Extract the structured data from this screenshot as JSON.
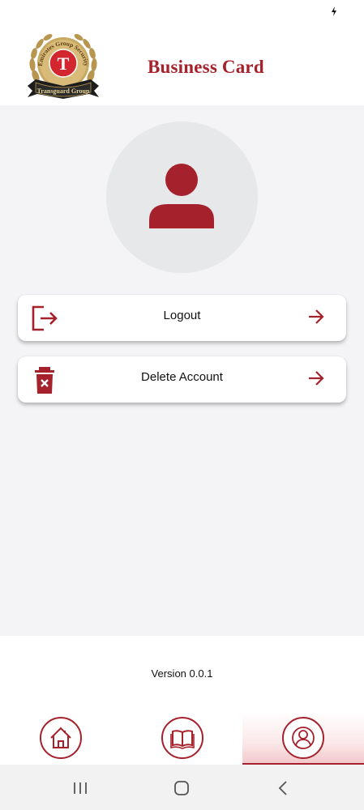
{
  "header": {
    "title": "Business Card",
    "logo": {
      "arc_text": "Emirates Group Security",
      "letter": "T",
      "banner_text": "Transguard Group"
    }
  },
  "profile": {
    "avatar_icon": "person-icon"
  },
  "menu": [
    {
      "label": "Logout",
      "icon": "logout-icon",
      "trail_icon": "arrow-right-icon"
    },
    {
      "label": "Delete Account",
      "icon": "trash-icon",
      "trail_icon": "arrow-right-icon"
    }
  ],
  "footer": {
    "version": "Version 0.0.1"
  },
  "bottom_nav": {
    "items": [
      {
        "icon": "home-icon",
        "active": false
      },
      {
        "icon": "book-icon",
        "active": false
      },
      {
        "icon": "profile-icon",
        "active": true
      }
    ]
  },
  "colors": {
    "brand": "#a5212c",
    "gold": "#b8964f",
    "background": "#f4f4f6"
  }
}
